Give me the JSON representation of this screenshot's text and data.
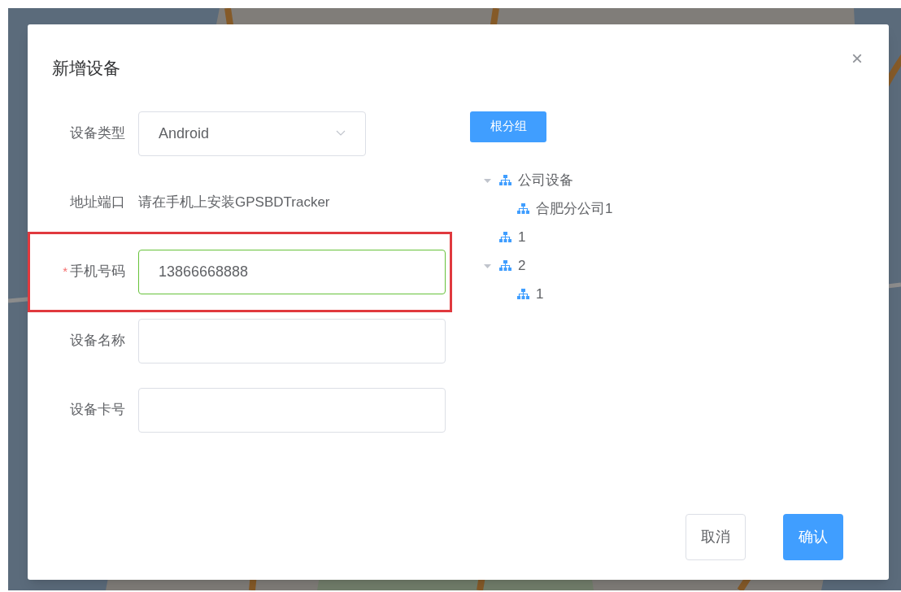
{
  "dialog": {
    "title": "新增设备",
    "close": "×"
  },
  "form": [
    {
      "kind": "select",
      "label": "设备类型",
      "value": "Android"
    },
    {
      "kind": "text",
      "label": "地址端口",
      "value": "请在手机上安装GPSBDTracker"
    },
    {
      "kind": "input",
      "label": "手机号码",
      "value": "13866668888",
      "required_mark": "*",
      "valid": true,
      "highlighted": true
    },
    {
      "kind": "input",
      "label": "设备名称",
      "valid": false
    },
    {
      "kind": "input",
      "label": "设备卡号",
      "valid": false
    }
  ],
  "root_group_button": "根分组",
  "tree": [
    {
      "label": "公司设备",
      "expanded": true,
      "children": [
        {
          "label": "合肥分公司1"
        }
      ]
    },
    {
      "label": "1"
    },
    {
      "label": "2",
      "expanded": true,
      "children": [
        {
          "label": "1"
        }
      ]
    }
  ],
  "buttons": [
    {
      "label": "取消",
      "kind": "secondary"
    },
    {
      "label": "确认",
      "kind": "primary"
    }
  ]
}
